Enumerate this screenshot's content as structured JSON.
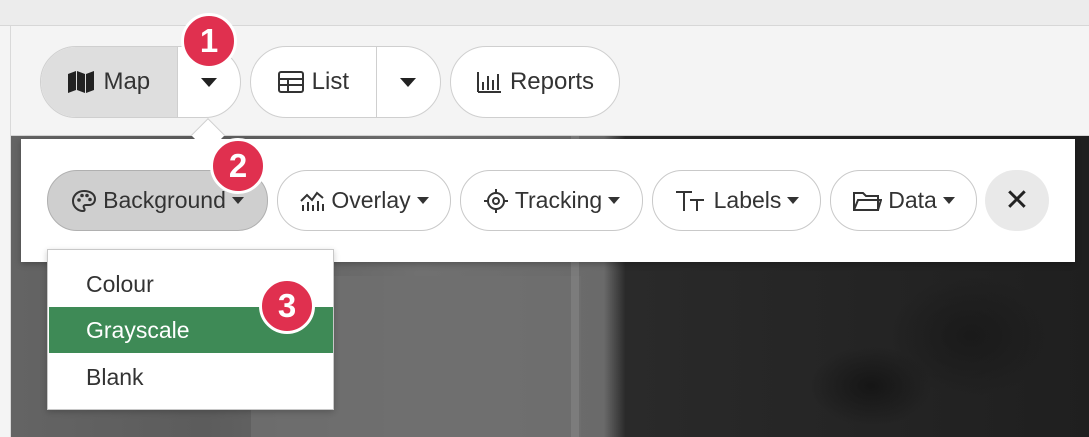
{
  "toolbar": {
    "map_label": "Map",
    "list_label": "List",
    "reports_label": "Reports"
  },
  "panel": {
    "buttons": {
      "background": "Background",
      "overlay": "Overlay",
      "tracking": "Tracking",
      "labels": "Labels",
      "data": "Data"
    },
    "close_label": "✕"
  },
  "menu": {
    "items": [
      {
        "label": "Colour",
        "selected": false
      },
      {
        "label": "Grayscale",
        "selected": true
      },
      {
        "label": "Blank",
        "selected": false
      }
    ]
  },
  "badges": [
    "1",
    "2",
    "3"
  ],
  "colors": {
    "accent_selected": "#3e8a56",
    "badge": "#e0304f",
    "active_button": "#dedede"
  },
  "icons": [
    "map-icon",
    "table-icon",
    "bar-chart-icon",
    "palette-icon",
    "overlay-chart-icon",
    "crosshair-icon",
    "text-size-icon",
    "folder-icon",
    "close-icon"
  ]
}
